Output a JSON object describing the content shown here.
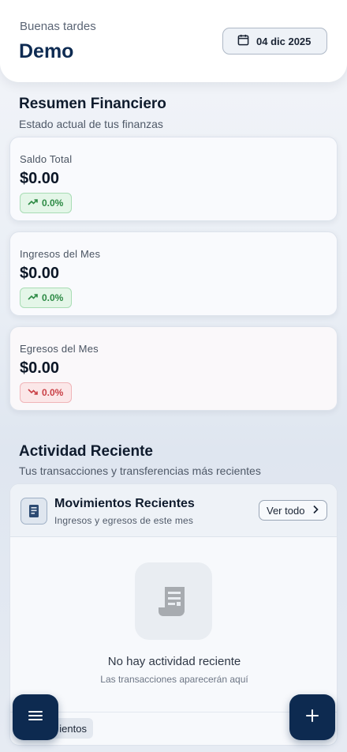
{
  "header": {
    "greeting": "Buenas tardes",
    "username": "Demo",
    "date_label": "04 dic 2025",
    "date_icon": "calendar-icon"
  },
  "summary": {
    "title": "Resumen Financiero",
    "subtitle": "Estado actual de tus finanzas",
    "cards": [
      {
        "label": "Saldo Total",
        "value": "$0.00",
        "change": "0.0%",
        "trend": "up"
      },
      {
        "label": "Ingresos del Mes",
        "value": "$0.00",
        "change": "0.0%",
        "trend": "up"
      },
      {
        "label": "Egresos del Mes",
        "value": "$0.00",
        "change": "0.0%",
        "trend": "down"
      }
    ]
  },
  "activity": {
    "title": "Actividad Reciente",
    "subtitle": "Tus transacciones y transferencias más recientes",
    "panel": {
      "title": "Movimientos Recientes",
      "subtitle": "Ingresos y egresos de este mes",
      "see_all_label": "Ver todo",
      "empty_title": "No hay actividad reciente",
      "empty_subtitle": "Las transacciones aparecerán aquí",
      "chip_label": "ientos"
    }
  },
  "colors": {
    "primary": "#0d2a50",
    "positive": "#2c8a44",
    "negative": "#c93f45"
  },
  "fabs": {
    "menu_icon": "menu-icon",
    "add_icon": "plus-icon"
  }
}
